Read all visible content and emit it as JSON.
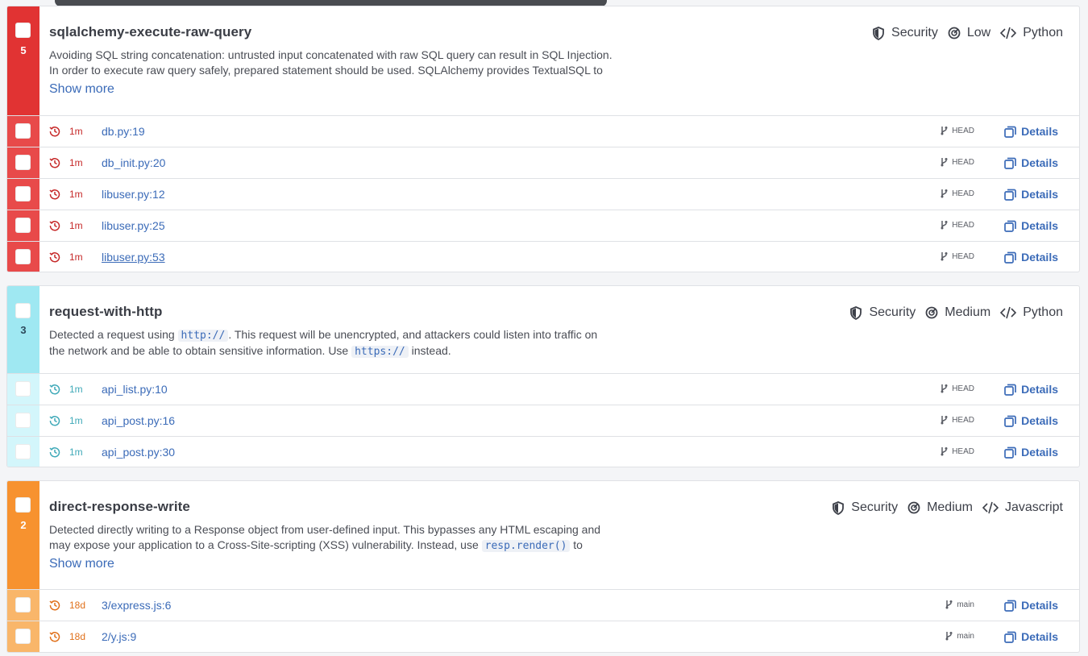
{
  "colors": {
    "high": "#e13333",
    "high_light": "#e84a4a",
    "cyan": "#9fe8f2",
    "cyan_light": "#d3f6fb",
    "orange": "#f7922f",
    "orange_light": "#f9b66a",
    "link": "#3b6bb8"
  },
  "rules": [
    {
      "count": "5",
      "title": "sqlalchemy-execute-raw-query",
      "category": "Security",
      "severity": "Low",
      "language": "Python",
      "desc_line1": "Avoiding SQL string concatenation: untrusted input concatenated with raw SQL query can result in SQL Injection.",
      "desc_line2": "In order to execute raw query safely, prepared statement should be used. SQLAlchemy provides TextualSQL to",
      "show_more": "Show more",
      "findings": [
        {
          "age": "1m",
          "file": "db.py:19",
          "branch": "HEAD",
          "details": "Details"
        },
        {
          "age": "1m",
          "file": "db_init.py:20",
          "branch": "HEAD",
          "details": "Details"
        },
        {
          "age": "1m",
          "file": "libuser.py:12",
          "branch": "HEAD",
          "details": "Details"
        },
        {
          "age": "1m",
          "file": "libuser.py:25",
          "branch": "HEAD",
          "details": "Details"
        },
        {
          "age": "1m",
          "file": "libuser.py:53",
          "branch": "HEAD",
          "details": "Details"
        }
      ]
    },
    {
      "count": "3",
      "title": "request-with-http",
      "category": "Security",
      "severity": "Medium",
      "language": "Python",
      "desc_a": "Detected a request using ",
      "desc_code1": "http://",
      "desc_b": ". This request will be unencrypted, and attackers could listen into traffic on",
      "desc_c": "the network and be able to obtain sensitive information. Use ",
      "desc_code2": "https://",
      "desc_d": " instead.",
      "findings": [
        {
          "age": "1m",
          "file": "api_list.py:10",
          "branch": "HEAD",
          "details": "Details"
        },
        {
          "age": "1m",
          "file": "api_post.py:16",
          "branch": "HEAD",
          "details": "Details"
        },
        {
          "age": "1m",
          "file": "api_post.py:30",
          "branch": "HEAD",
          "details": "Details"
        }
      ]
    },
    {
      "count": "2",
      "title": "direct-response-write",
      "category": "Security",
      "severity": "Medium",
      "language": "Javascript",
      "desc_line1": "Detected directly writing to a Response object from user-defined input. This bypasses any HTML escaping and",
      "desc_a": "may expose your application to a Cross-Site-scripting (XSS) vulnerability. Instead, use ",
      "desc_code": "resp.render()",
      "desc_b": " to",
      "show_more": "Show more",
      "findings": [
        {
          "age": "18d",
          "file": "3/express.js:6",
          "branch": "main",
          "details": "Details"
        },
        {
          "age": "18d",
          "file": "2/y.js:9",
          "branch": "main",
          "details": "Details"
        }
      ]
    }
  ]
}
